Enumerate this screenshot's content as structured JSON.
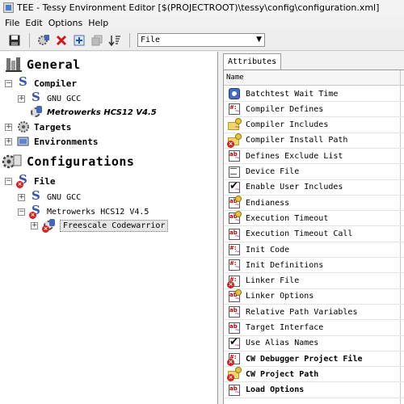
{
  "window": {
    "title": "TEE - Tessy Environment Editor [$(PROJECTROOT)\\tessy\\config\\configuration.xml]"
  },
  "menu": [
    "File",
    "Edit",
    "Options",
    "Help"
  ],
  "toolbar": {
    "buttons": [
      "save-icon",
      "properties-icon",
      "delete-icon",
      "add-icon",
      "copy-icon",
      "sort-icon"
    ],
    "filter_select": {
      "value": "File"
    }
  },
  "tree": {
    "general": {
      "label": "General",
      "compiler": {
        "label": "Compiler",
        "items": [
          "GNU GCC",
          "Metrowerks HCS12 V4.5"
        ]
      },
      "targets": {
        "label": "Targets"
      },
      "environments": {
        "label": "Environments"
      }
    },
    "configurations": {
      "label": "Configurations",
      "file": {
        "label": "File",
        "items": [
          "GNU GCC",
          "Metrowerks HCS12 V4.5"
        ],
        "selected": "Freescale Codewarrior"
      }
    }
  },
  "attributes": {
    "tab": "Attributes",
    "column_header": "Name",
    "rows": [
      {
        "label": "Batchtest Wait Time",
        "icon": "clock-icon",
        "bold": false
      },
      {
        "label": "Compiler Defines",
        "icon": "defines-icon",
        "bold": false
      },
      {
        "label": "Compiler Includes",
        "icon": "folder-icon",
        "bold": false
      },
      {
        "label": "Compiler Install Path",
        "icon": "folder-error-icon",
        "bold": false
      },
      {
        "label": "Defines Exclude List",
        "icon": "string-icon",
        "bold": false
      },
      {
        "label": "Device File",
        "icon": "file-icon",
        "bold": false
      },
      {
        "label": "Enable User Includes",
        "icon": "checkbox-icon",
        "bold": false
      },
      {
        "label": "Endianess",
        "icon": "string-bulb-icon",
        "bold": false
      },
      {
        "label": "Execution Timeout",
        "icon": "string-bulb-icon",
        "bold": false
      },
      {
        "label": "Execution Timeout Call",
        "icon": "string-icon",
        "bold": false
      },
      {
        "label": "Init Code",
        "icon": "defines-icon",
        "bold": false
      },
      {
        "label": "Init Definitions",
        "icon": "defines-icon",
        "bold": false
      },
      {
        "label": "Linker File",
        "icon": "file-error-icon",
        "bold": false
      },
      {
        "label": "Linker Options",
        "icon": "string-bulb-icon",
        "bold": false
      },
      {
        "label": "Relative Path Variables",
        "icon": "string-icon",
        "bold": false
      },
      {
        "label": "Target Interface",
        "icon": "string-icon",
        "bold": false
      },
      {
        "label": "Use Alias Names",
        "icon": "checkbox-icon",
        "bold": false
      },
      {
        "label": "CW Debugger Project File",
        "icon": "file-error-icon",
        "bold": true
      },
      {
        "label": "CW Project Path",
        "icon": "folder-error-icon",
        "bold": true
      },
      {
        "label": "Load Options",
        "icon": "string-icon",
        "bold": true
      }
    ]
  },
  "colors": {
    "selection_bg": "#e6e6e6",
    "error": "#d42020",
    "folder": "#f0d470"
  }
}
